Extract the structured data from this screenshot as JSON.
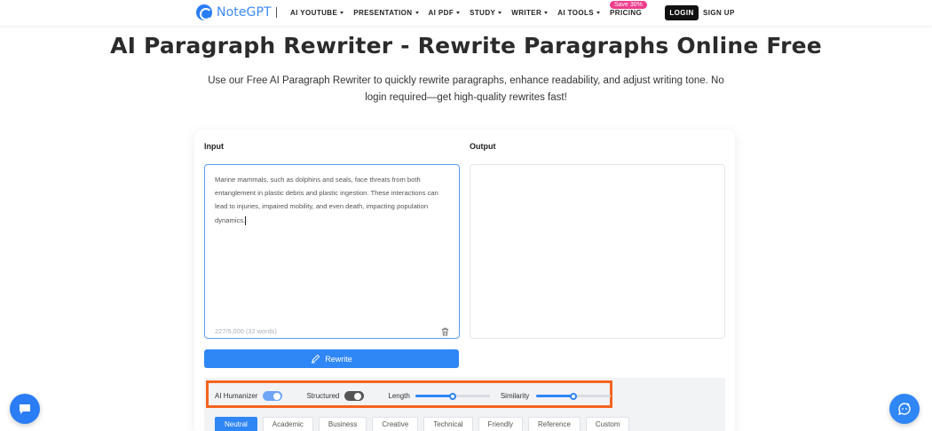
{
  "header": {
    "logo_text": "NoteGPT",
    "nav": [
      {
        "label": "AI YOUTUBE"
      },
      {
        "label": "PRESENTATION"
      },
      {
        "label": "AI PDF"
      },
      {
        "label": "STUDY"
      },
      {
        "label": "WRITER"
      },
      {
        "label": "AI TOOLS"
      },
      {
        "label": "PRICING"
      }
    ],
    "pricing_badge": "Save 30%",
    "login_label": "LOGIN",
    "signup_label": "SIGN UP"
  },
  "hero": {
    "title": "AI Paragraph Rewriter - Rewrite Paragraphs Online Free",
    "subtitle": "Use our Free AI Paragraph Rewriter to quickly rewrite paragraphs, enhance readability, and adjust writing tone. No login required—get high-quality rewrites fast!"
  },
  "editor": {
    "input_label": "Input",
    "output_label": "Output",
    "input_text": "Marine mammals, such as dolphins and seals, face threats from both entanglement in plastic debris and plastic ingestion. These interactions can lead to injuries, impaired mobility, and even death, impacting population dynamics.",
    "char_count": "227/5,000 (32 words)",
    "rewrite_label": "Rewrite"
  },
  "options": {
    "ai_humanizer_label": "AI Humanizer",
    "ai_humanizer_on": true,
    "structured_label": "Structured",
    "structured_on": false,
    "length_label": "Length",
    "length_level": 0.5,
    "similarity_label": "Similarity",
    "similarity_level": 0.5
  },
  "tones": [
    {
      "label": "Neutral",
      "active": true
    },
    {
      "label": "Academic",
      "active": false
    },
    {
      "label": "Business",
      "active": false
    },
    {
      "label": "Creative",
      "active": false
    },
    {
      "label": "Technical",
      "active": false
    },
    {
      "label": "Friendly",
      "active": false
    },
    {
      "label": "Reference",
      "active": false
    },
    {
      "label": "Custom",
      "active": false
    }
  ],
  "icons": {
    "chat": "chat-icon",
    "assistant": "assistant-icon",
    "trash": "trash-icon",
    "rewrite": "rewrite-icon"
  },
  "colors": {
    "accent": "#2f86f5",
    "highlight": "#f4641e",
    "badge": "#ee3d8d"
  }
}
